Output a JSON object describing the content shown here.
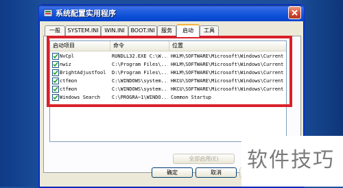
{
  "window": {
    "title": "系统配置实用程序"
  },
  "tabs": [
    {
      "label": "一般"
    },
    {
      "label": "SYSTEM.INI"
    },
    {
      "label": "WIN.INI"
    },
    {
      "label": "BOOT.INI"
    },
    {
      "label": "服务"
    },
    {
      "label": "启动"
    },
    {
      "label": "工具"
    }
  ],
  "active_tab": "启动",
  "list": {
    "headers": [
      "启动项目",
      "命令",
      "位置"
    ],
    "rows": [
      {
        "checked": true,
        "item": "NvCpl",
        "command": "RUNDLL32.EXE C:\\W...",
        "location": "HKLM\\SOFTWARE\\Microsoft\\Windows\\Current..."
      },
      {
        "checked": true,
        "item": "nwiz",
        "command": "C:\\Program Files\\...",
        "location": "HKLM\\SOFTWARE\\Microsoft\\Windows\\Current..."
      },
      {
        "checked": true,
        "item": "BrightAdjustTool",
        "command": "D:\\Program Files\\...",
        "location": "HKLM\\SOFTWARE\\Microsoft\\Windows\\Current..."
      },
      {
        "checked": true,
        "item": "ctfmon",
        "command": "C:\\WINDOWS\\system...",
        "location": "HKCU\\SOFTWARE\\Microsoft\\Windows\\Current..."
      },
      {
        "checked": true,
        "item": "ctfmon",
        "command": "C:\\WINDOWS\\system...",
        "location": "HKCU\\SOFTWARE\\Microsoft\\Windows\\Current..."
      },
      {
        "checked": true,
        "item": "Windows Search",
        "command": "C:\\PROGRA~1\\WINDO...",
        "location": "Common Startup"
      }
    ]
  },
  "buttons": {
    "enable_all": "全部启用(E)",
    "ok": "确定",
    "cancel": "取消",
    "apply": "应"
  },
  "watermark": {
    "text": "软件技巧"
  },
  "colors": {
    "highlight": "#d9202a",
    "titlebar": "#0b4fd8",
    "desktop": "#16458f"
  }
}
